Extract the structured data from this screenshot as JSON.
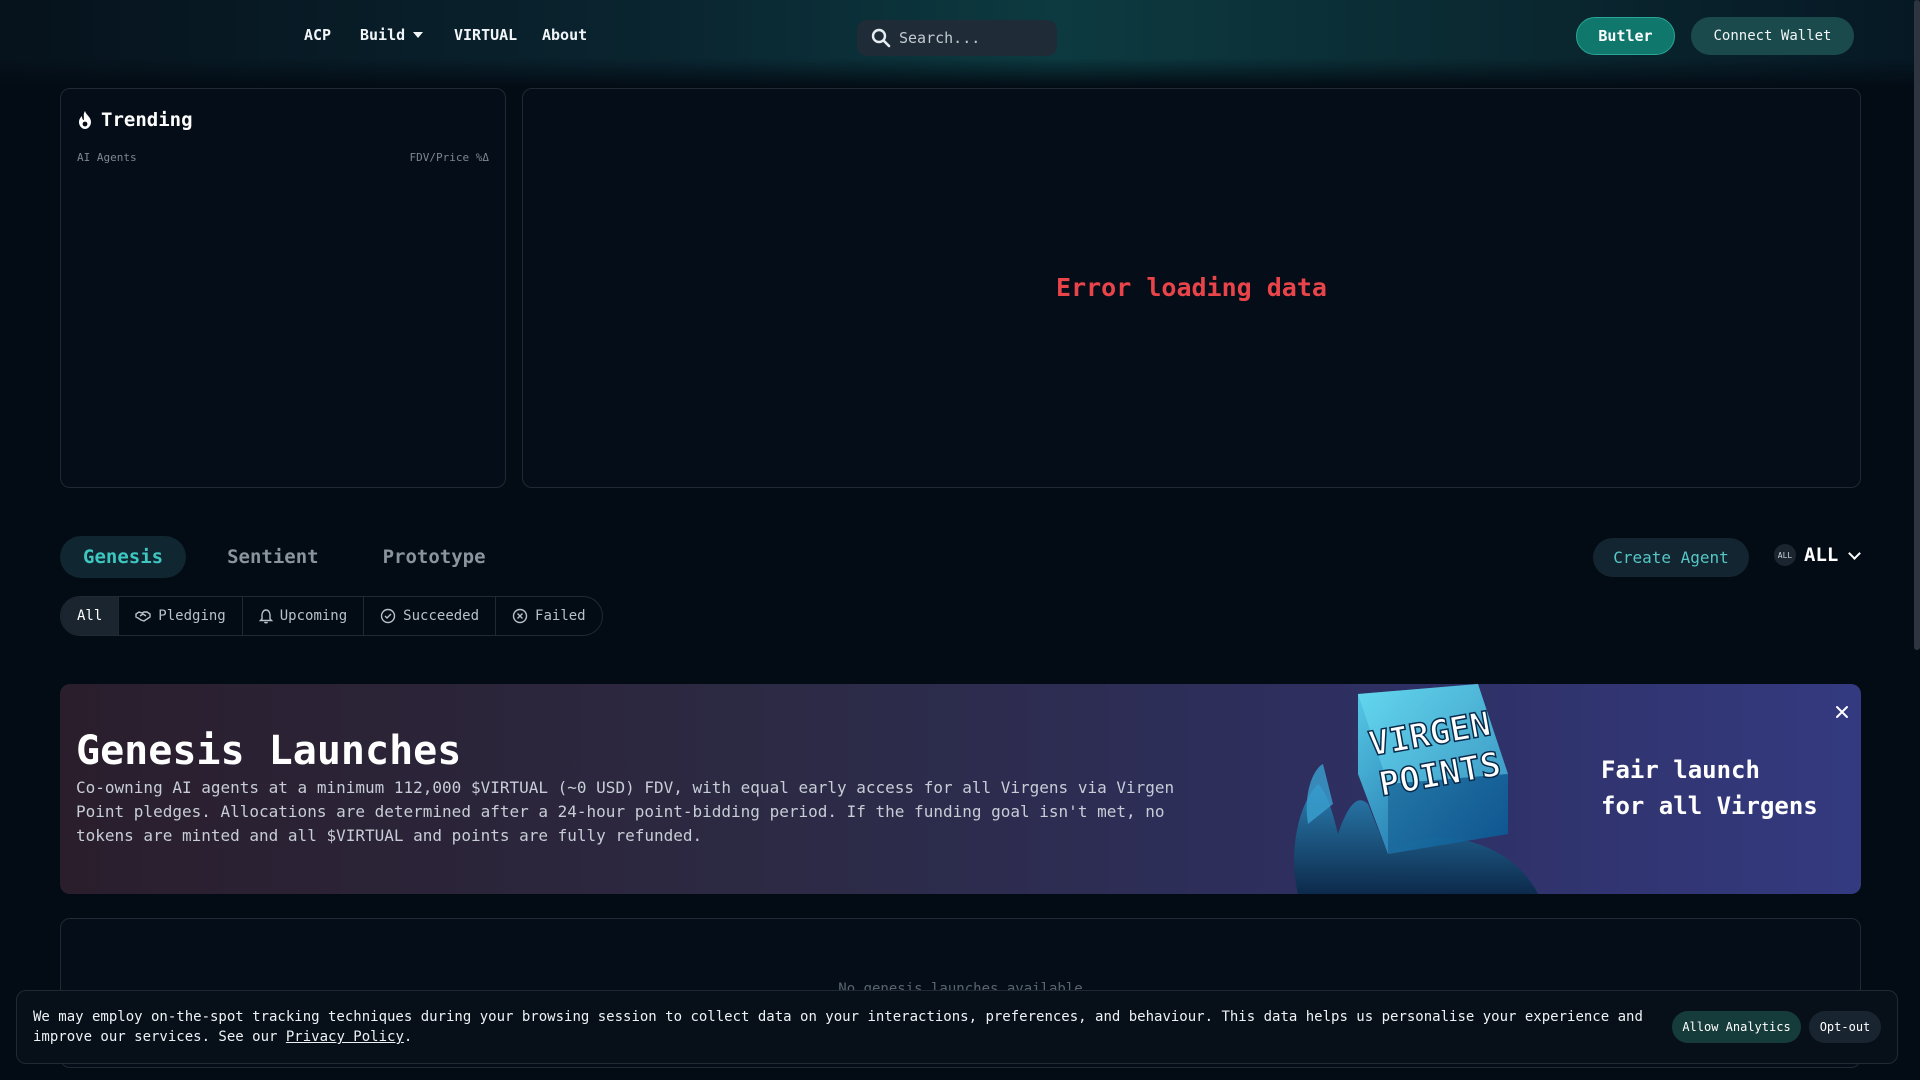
{
  "nav": {
    "links": [
      "ACP",
      "Build",
      "VIRTUAL",
      "About"
    ],
    "search_placeholder": "Search...",
    "butler_label": "Butler",
    "wallet_label": "Connect Wallet"
  },
  "trending": {
    "title": "Trending",
    "col_left": "AI Agents",
    "col_right": "FDV/Price %Δ"
  },
  "main_panel": {
    "error": "Error loading data"
  },
  "tabs": [
    "Genesis",
    "Sentient",
    "Prototype"
  ],
  "active_tab": "Genesis",
  "create_agent_label": "Create Agent",
  "chain_filter": {
    "badge": "ALL",
    "label": "ALL"
  },
  "filters": [
    {
      "label": "All",
      "icon": ""
    },
    {
      "label": "Pledging",
      "icon": "handshake-icon"
    },
    {
      "label": "Upcoming",
      "icon": "bell-icon"
    },
    {
      "label": "Succeeded",
      "icon": "check-circle-icon"
    },
    {
      "label": "Failed",
      "icon": "x-circle-icon"
    }
  ],
  "banner": {
    "title": "Genesis Launches",
    "description": "Co-owning AI agents at a minimum 112,000 $VIRTUAL (~0 USD) FDV, with equal early access for all Virgens via Virgen Point pledges. Allocations are determined after a 24-hour point-bidding period. If the funding goal isn't met, no tokens are minted and all $VIRTUAL and points are fully refunded.",
    "art_text_1": "VIRGEN",
    "art_text_2": "POINTS",
    "tagline_1": "Fair launch",
    "tagline_2": "for all Virgens"
  },
  "empty_state": "No genesis launches available",
  "cookie": {
    "text": "We may employ on-the-spot tracking techniques during your browsing session to collect data on your interactions, preferences, and behaviour. This data helps us personalise your experience and improve our services. See our ",
    "link": "Privacy Policy",
    "after": ".",
    "allow_label": "Allow Analytics",
    "opt_label": "Opt-out"
  },
  "colors": {
    "accent": "#3ec6c0",
    "error": "#e9444a",
    "butler": "#10776c"
  }
}
